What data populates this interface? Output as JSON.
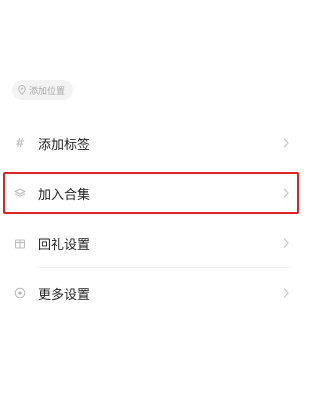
{
  "location_chip": {
    "label": "添加位置",
    "icon": "location-pin-icon"
  },
  "menu": {
    "items": [
      {
        "label": "添加标签",
        "icon": "hash-icon"
      },
      {
        "label": "加入合集",
        "icon": "collection-layers-icon",
        "highlighted": true
      },
      {
        "label": "回礼设置",
        "icon": "gift-icon"
      },
      {
        "label": "更多设置",
        "icon": "settings-circle-icon"
      }
    ]
  },
  "colors": {
    "highlight_border": "#e02424",
    "muted_icon": "#b8b8b8",
    "chip_bg": "#f3f3f3"
  }
}
